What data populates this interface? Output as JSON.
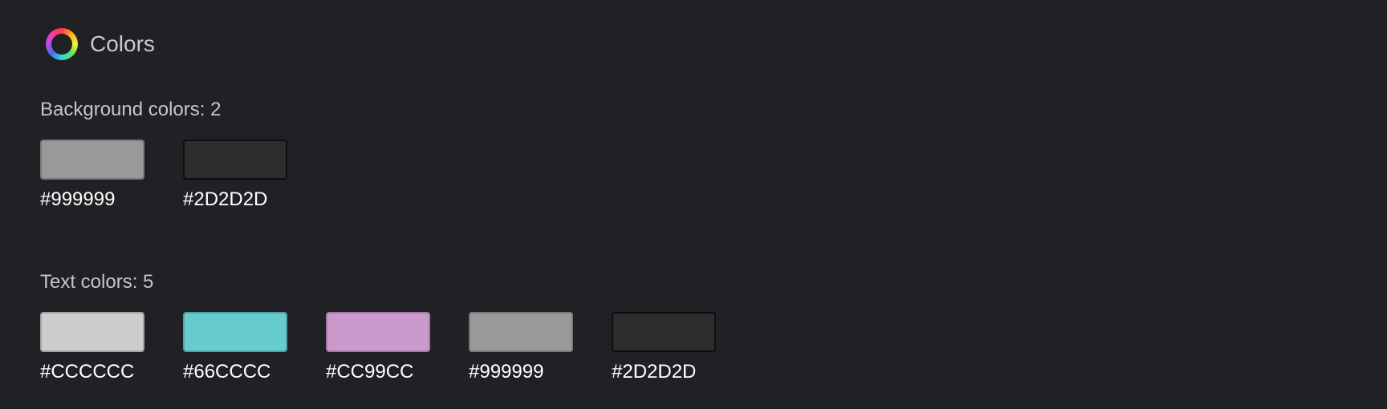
{
  "header": {
    "title": "Colors",
    "icon": "color-wheel-icon"
  },
  "background_colors": {
    "label": "Background colors: 2",
    "swatches": [
      {
        "code": "#999999",
        "color": "#999999",
        "border": "#7a7a7a"
      },
      {
        "code": "#2D2D2D",
        "color": "#2D2D2D",
        "border": "#0e0e0f"
      }
    ]
  },
  "text_colors": {
    "label": "Text colors: 5",
    "swatches": [
      {
        "code": "#CCCCCC",
        "color": "#CCCCCC",
        "border": "#a3a3a3"
      },
      {
        "code": "#66CCCC",
        "color": "#66CCCC",
        "border": "#52a3a3"
      },
      {
        "code": "#CC99CC",
        "color": "#CC99CC",
        "border": "#a37aa3"
      },
      {
        "code": "#999999",
        "color": "#999999",
        "border": "#7a7a7a"
      },
      {
        "code": "#2D2D2D",
        "color": "#2D2D2D",
        "border": "#0e0e0f"
      }
    ]
  }
}
